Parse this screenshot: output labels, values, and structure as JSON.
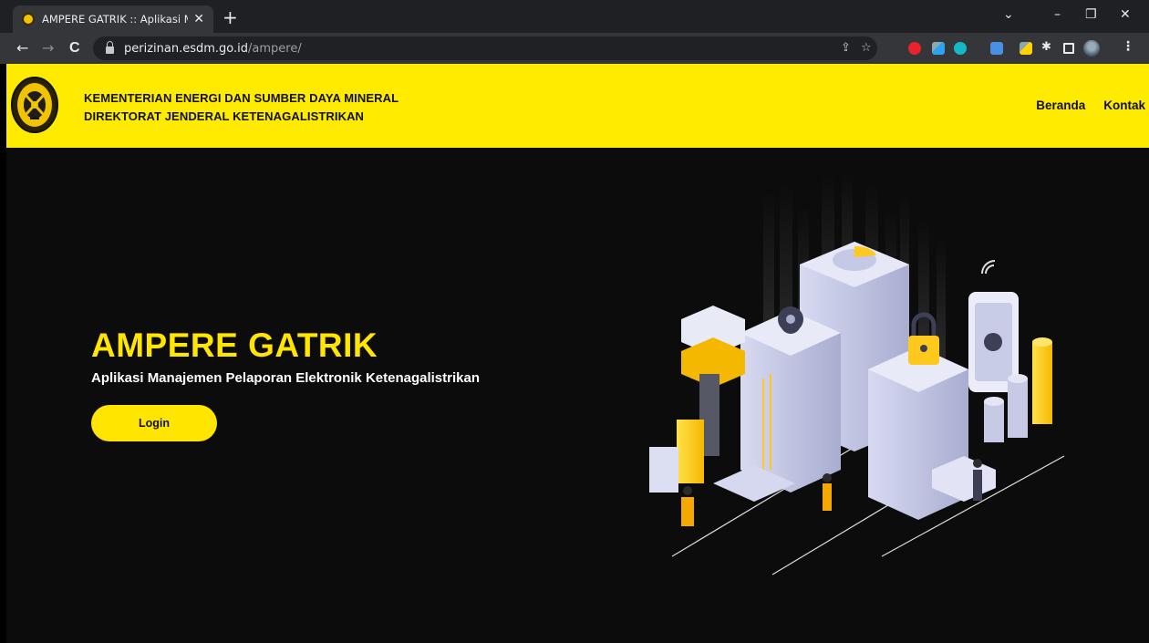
{
  "browser": {
    "tab_title": "AMPERE GATRIK :: Aplikasi Mana",
    "tab_close": "✕",
    "new_tab": "+",
    "url_host": "perizinan.esdm.go.id",
    "url_path": "/ampere/",
    "controls": {
      "dropdown": "⌄",
      "minimize": "–",
      "restore": "❐",
      "close": "✕"
    },
    "nav": {
      "back": "←",
      "forward": "→",
      "reload": "C"
    },
    "omni_icons": {
      "share": "⇪",
      "bookmark": "☆"
    },
    "extension_colors": [
      "#e8232a",
      "#2ea3f2",
      "#16b8c8",
      "#4a90e2",
      "#ffd400",
      "#ffffff"
    ]
  },
  "header": {
    "org_line1": "KEMENTERIAN ENERGI DAN SUMBER DAYA MINERAL",
    "org_line2": "DIREKTORAT JENDERAL KETENAGALISTRIKAN",
    "nav": [
      {
        "label": "Beranda"
      },
      {
        "label": "Kontak"
      }
    ],
    "bg_color": "#ffeb00"
  },
  "hero": {
    "title": "AMPERE GATRIK",
    "subtitle": "Aplikasi Manajemen Pelaporan Elektronik Ketenagalistrikan",
    "login_label": "Login",
    "accent_color": "#ffe500"
  }
}
